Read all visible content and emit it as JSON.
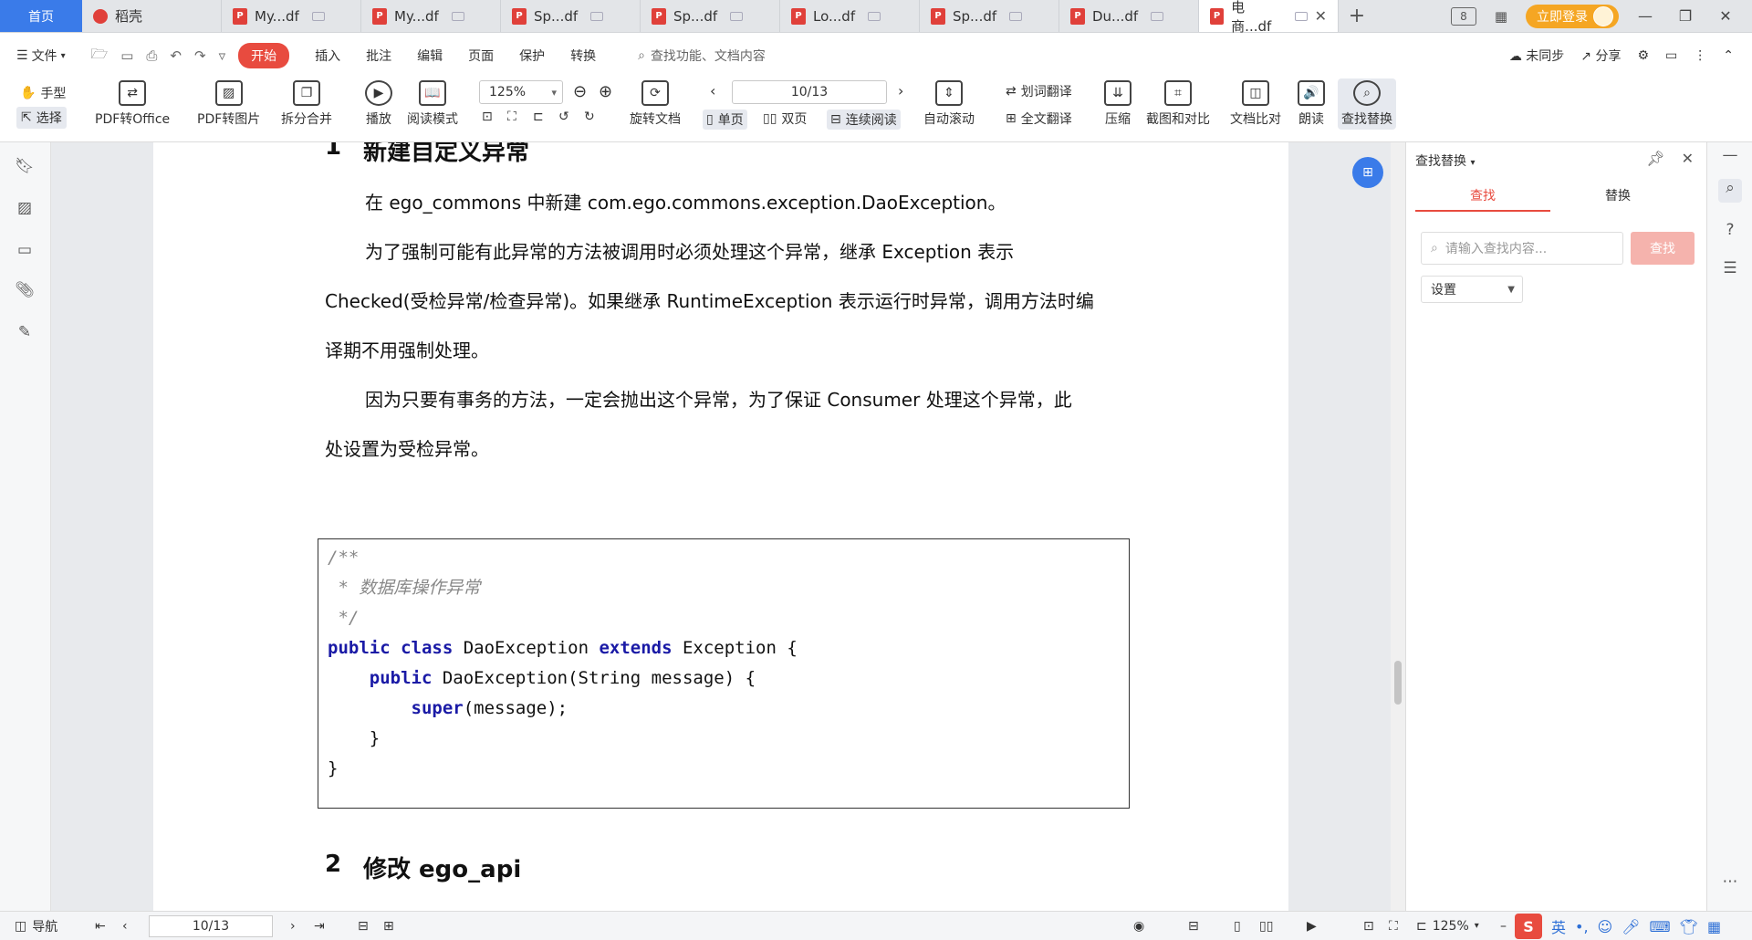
{
  "tabs": {
    "home": "首页",
    "items": [
      {
        "label": "稻壳",
        "type": "daoke"
      },
      {
        "label": "My...df",
        "type": "pdf"
      },
      {
        "label": "My...df",
        "type": "pdf"
      },
      {
        "label": "Sp...df",
        "type": "pdf"
      },
      {
        "label": "Sp...df",
        "type": "pdf"
      },
      {
        "label": "Lo...df",
        "type": "pdf"
      },
      {
        "label": "Sp...df",
        "type": "pdf"
      },
      {
        "label": "Du...df",
        "type": "pdf"
      },
      {
        "label": "电商...df",
        "type": "pdf",
        "active": true
      }
    ],
    "add": "+",
    "login": "立即登录",
    "badge": "8"
  },
  "menu": {
    "file": "文件",
    "start": "开始",
    "items": [
      "插入",
      "批注",
      "编辑",
      "页面",
      "保护",
      "转换"
    ],
    "search": "查找功能、文档内容",
    "unsync": "未同步",
    "share": "分享"
  },
  "toolbar": {
    "hand": "手型",
    "select": "选择",
    "pdf_office": "PDF转Office",
    "pdf_image": "PDF转图片",
    "split_merge": "拆分合并",
    "play": "播放",
    "read_mode": "阅读模式",
    "zoom": "125%",
    "rotate": "旋转文档",
    "page": "10/13",
    "single": "单页",
    "double": "双页",
    "continuous": "连续阅读",
    "auto_scroll": "自动滚动",
    "word_translate": "划词翻译",
    "full_translate": "全文翻译",
    "compress": "压缩",
    "screenshot_compare": "截图和对比",
    "doc_compare": "文档比对",
    "read_aloud": "朗读",
    "find_replace": "查找替换"
  },
  "doc": {
    "h1_num": "1",
    "h1": "新建自定义异常",
    "p1": "在 ego_commons 中新建 com.ego.commons.exception.DaoException。",
    "p2a": "为了强制可能有此异常的方法被调用时必须处理这个异常，继承 Exception 表示",
    "p2b": "Checked(受检异常/检查异常)。如果继承 RuntimeException 表示运行时异常，调用方法时编",
    "p2c": "译期不用强制处理。",
    "p3a": "因为只要有事务的方法，一定会抛出这个异常，为了保证 Consumer 处理这个异常，此",
    "p3b": "处设置为受检异常。",
    "code": {
      "c1": "/**",
      "c2": " * 数据库操作异常",
      "c3": " */",
      "l4_kw1": "public",
      "l4_kw2": "class",
      "l4_name": " DaoException ",
      "l4_kw3": "extends",
      "l4_rest": " Exception {",
      "l5_kw": "public",
      "l5_rest": " DaoException(String message) {",
      "l6_kw": "super",
      "l6_rest": "(message);",
      "l7": "    }",
      "l8": "}"
    },
    "h2_num": "2",
    "h2": "修改 ego_api"
  },
  "panel": {
    "title": "查找替换",
    "tab_find": "查找",
    "tab_replace": "替换",
    "placeholder": "请输入查找内容...",
    "find_btn": "查找",
    "settings": "设置"
  },
  "status": {
    "nav": "导航",
    "page": "10/13",
    "zoom": "125%",
    "ime_lang": "英"
  }
}
